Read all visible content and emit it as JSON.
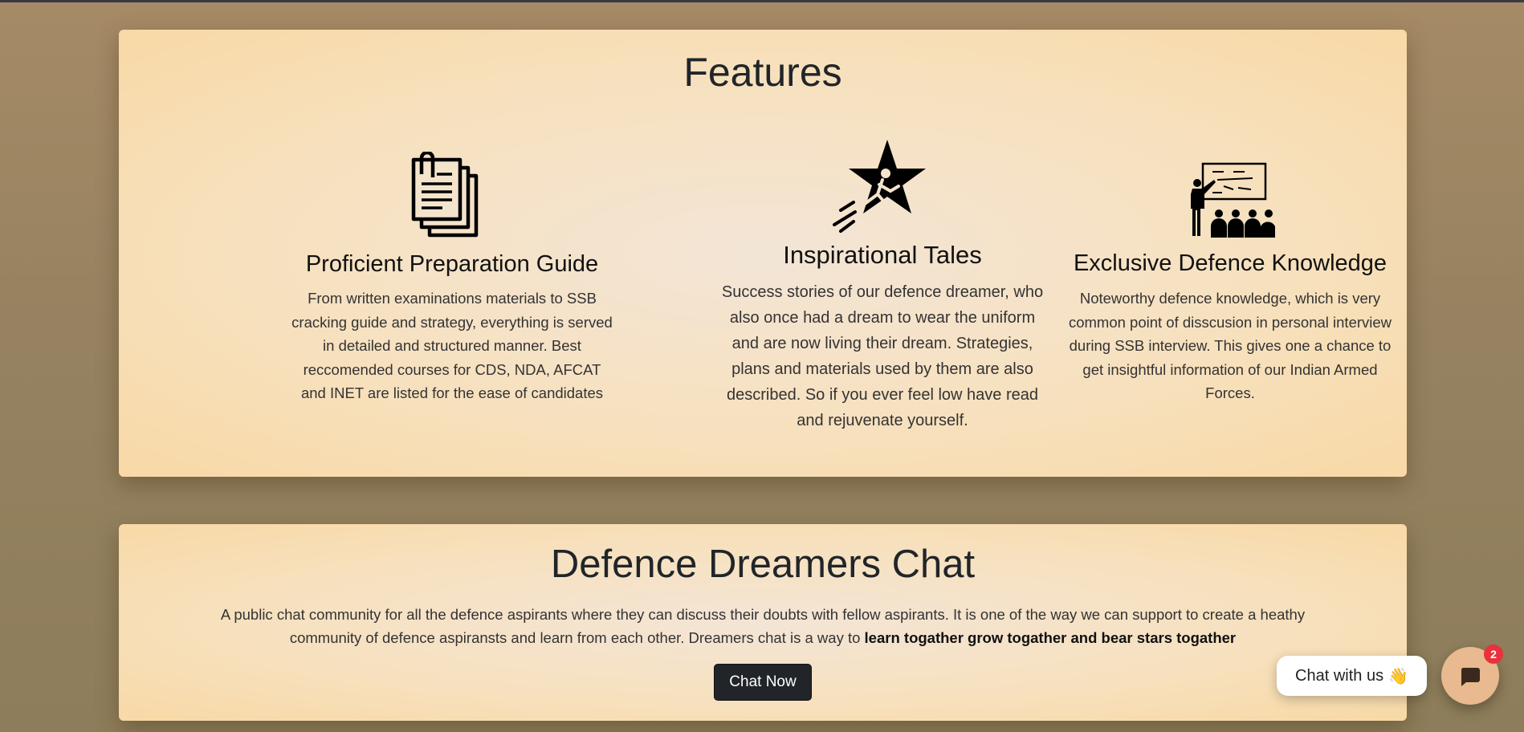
{
  "features": {
    "title": "Features",
    "items": [
      {
        "icon": "documents-icon",
        "title": "Proficient Preparation Guide",
        "description": "From written examinations materials to SSB cracking guide and strategy, everything is served in detailed and structured manner. Best reccomended courses for CDS, NDA, AFCAT and INET are listed for the ease of candidates"
      },
      {
        "icon": "star-runner-icon",
        "title": "Inspirational Tales",
        "description": "Success stories of our defence dreamer, who also once had a dream to wear the uniform and are now living their dream. Strategies, plans and materials used by them are also described. So if you ever feel low have read and rejuvenate yourself."
      },
      {
        "icon": "presentation-icon",
        "title": "Exclusive Defence Knowledge",
        "description": "Noteworthy defence knowledge, which is very common point of disscusion in personal interview during SSB interview. This gives one a chance to get insightful information of our Indian Armed Forces."
      }
    ]
  },
  "chat_section": {
    "title": "Defence Dreamers Chat",
    "description": "A public chat community for all the defence aspirants where they can discuss their doubts with fellow aspirants. It is one of the way we can support to create a heathy community of defence aspiransts and learn from each other. Dreamers chat is a way to ",
    "description_bold": "learn togather grow togather and bear stars togather",
    "button_label": "Chat Now"
  },
  "chat_widget": {
    "pill_label": "Chat with us",
    "pill_emoji": "👋",
    "badge_count": "2",
    "icon": "chat-bubble-icon"
  },
  "colors": {
    "panel": "#f7e0bc",
    "button": "#212529",
    "badge": "#e8313c",
    "fab": "#e9b98f"
  }
}
